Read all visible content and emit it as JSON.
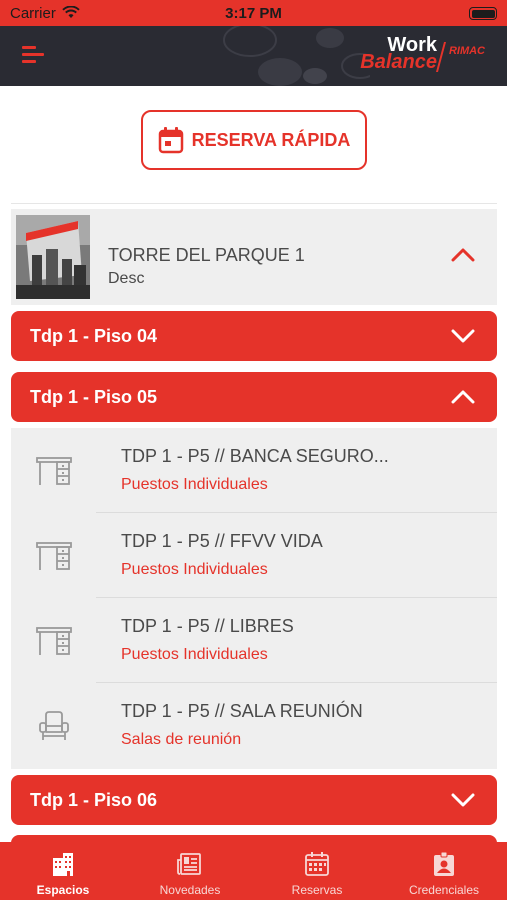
{
  "status_bar": {
    "carrier": "Carrier",
    "time": "3:17 PM"
  },
  "header": {
    "logo_top": "Work",
    "logo_bottom": "Balance",
    "logo_brand": "RIMAC"
  },
  "quick_reserve": {
    "label": "RESERVA RÁPIDA"
  },
  "building": {
    "name": "TORRE DEL PARQUE 1",
    "desc": "Desc",
    "expanded": true
  },
  "floors": [
    {
      "label": "Tdp 1 - Piso 04",
      "expanded": false
    },
    {
      "label": "Tdp 1 - Piso 05",
      "expanded": true
    },
    {
      "label": "Tdp 1 - Piso 06",
      "expanded": false
    }
  ],
  "spaces": [
    {
      "name": "TDP 1 - P5 // BANCA SEGURO...",
      "type": "Puestos Individuales",
      "icon": "desk-icon"
    },
    {
      "name": "TDP 1 - P5 // FFVV VIDA",
      "type": "Puestos Individuales",
      "icon": "desk-icon"
    },
    {
      "name": "TDP 1 - P5 // LIBRES",
      "type": "Puestos Individuales",
      "icon": "desk-icon"
    },
    {
      "name": "TDP 1 - P5 // SALA REUNIÓN",
      "type": "Salas de reunión",
      "icon": "armchair-icon"
    }
  ],
  "tabs": [
    {
      "label": "Espacios",
      "icon": "building-icon",
      "active": true
    },
    {
      "label": "Novedades",
      "icon": "newspaper-icon",
      "active": false
    },
    {
      "label": "Reservas",
      "icon": "calendar-icon",
      "active": false
    },
    {
      "label": "Credenciales",
      "icon": "id-badge-icon",
      "active": false
    }
  ],
  "colors": {
    "accent": "#e5332a",
    "header_bg": "#2a2b33",
    "row_bg": "#efefef",
    "text": "#4a4a4a"
  }
}
